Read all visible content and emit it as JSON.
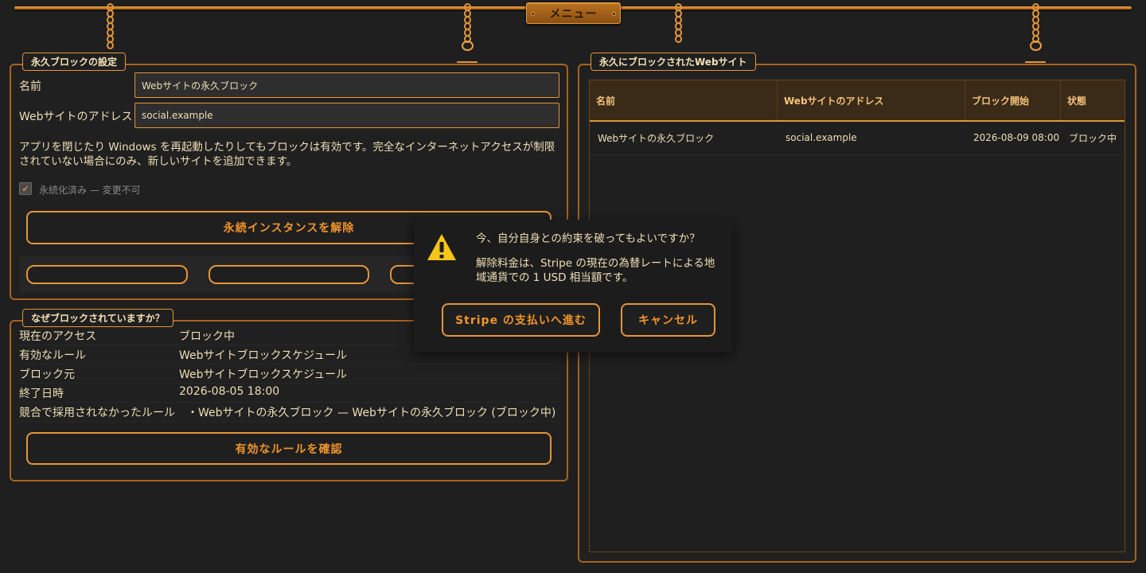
{
  "menu": {
    "label": "メニュー"
  },
  "settings": {
    "legend": "永久ブロックの設定",
    "name_label": "名前",
    "name_value": "Webサイトの永久ブロック",
    "address_label": "Webサイトのアドレス",
    "address_value": "social.example",
    "description": "アプリを閉じたり Windows を再起動したりしてもブロックは有効です。完全なインターネットアクセスが制限されていない場合にのみ、新しいサイトを追加できます。",
    "checkbox_label": "永続化済み — 変更不可",
    "unlock_button": "永続インスタンスを解除"
  },
  "why": {
    "legend": "なぜブロックされていますか？",
    "rows": [
      {
        "key": "現在のアクセス",
        "value": "ブロック中"
      },
      {
        "key": "有効なルール",
        "value": "Webサイトブロックスケジュール"
      },
      {
        "key": "ブロック元",
        "value": "Webサイトブロックスケジュール"
      },
      {
        "key": "終了日時",
        "value": "2026-08-05 18:00"
      },
      {
        "key": "競合で採用されなかったルール",
        "value": "・Webサイトの永久ブロック — Webサイトの永久ブロック (ブロック中)"
      }
    ],
    "confirm_button": "有効なルールを確認"
  },
  "blocked_sites": {
    "legend": "永久にブロックされたWebサイト",
    "columns": [
      "名前",
      "Webサイトのアドレス",
      "ブロック開始",
      "状態"
    ],
    "rows": [
      [
        "Webサイトの永久ブロック",
        "social.example",
        "2026-08-09 08:00",
        "ブロック中"
      ]
    ]
  },
  "dialog": {
    "icon": "warning-icon",
    "question": "今、自分自身との約束を破ってもよいですか？",
    "detail": "解除料金は、Stripe の現在の為替レートによる地域通貨での 1 USD 相当額です。",
    "proceed_button": "Stripe の支払いへ進む",
    "cancel_button": "キャンセル"
  },
  "colors": {
    "accent": "#e3953a",
    "background": "#1f1f1f",
    "text": "#f0dfb6"
  }
}
